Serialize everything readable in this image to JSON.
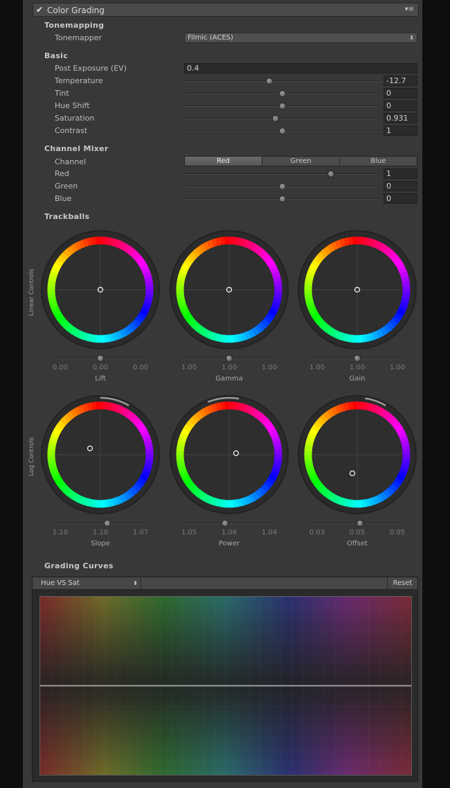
{
  "header": {
    "title": "Color Grading",
    "enabled": true,
    "menu_icon": "settings-menu-icon"
  },
  "tonemapping": {
    "section": "Tonemapping",
    "tonemapper_label": "Tonemapper",
    "tonemapper_value": "Filmic (ACES)"
  },
  "basic": {
    "section": "Basic",
    "post_exposure_label": "Post Exposure (EV)",
    "post_exposure_value": "0.4",
    "sliders": [
      {
        "label": "Temperature",
        "value": "-12.7",
        "pos": 0.436
      },
      {
        "label": "Tint",
        "value": "0",
        "pos": 0.5
      },
      {
        "label": "Hue Shift",
        "value": "0",
        "pos": 0.5
      },
      {
        "label": "Saturation",
        "value": "0.931",
        "pos": 0.465
      },
      {
        "label": "Contrast",
        "value": "1",
        "pos": 0.5
      }
    ]
  },
  "channel_mixer": {
    "section": "Channel Mixer",
    "channel_label": "Channel",
    "tabs": [
      "Red",
      "Green",
      "Blue"
    ],
    "active_tab": 0,
    "sliders": [
      {
        "label": "Red",
        "value": "1",
        "pos": 0.75
      },
      {
        "label": "Green",
        "value": "0",
        "pos": 0.5
      },
      {
        "label": "Blue",
        "value": "0",
        "pos": 0.5
      }
    ]
  },
  "trackballs": {
    "section": "Trackballs",
    "linear_label": "Linear Controls",
    "log_label": "Log Controls",
    "linear": [
      {
        "name": "Lift",
        "values": [
          "0.00",
          "0.00",
          "0.00"
        ],
        "slider": 0.5
      },
      {
        "name": "Gamma",
        "values": [
          "1.00",
          "1.00",
          "1.00"
        ],
        "slider": 0.5
      },
      {
        "name": "Gain",
        "values": [
          "1.00",
          "1.00",
          "1.00"
        ],
        "slider": 0.5
      }
    ],
    "log": [
      {
        "name": "Slope",
        "values": [
          "1.10",
          "1.10",
          "1.07"
        ],
        "slider": 0.58
      },
      {
        "name": "Power",
        "values": [
          "1.05",
          "1.06",
          "1.04"
        ],
        "slider": 0.45
      },
      {
        "name": "Offset",
        "values": [
          "0.03",
          "0.05",
          "0.05"
        ],
        "slider": 0.53
      }
    ]
  },
  "grading_curves": {
    "section": "Grading Curves",
    "curve_type": "Hue VS Sat",
    "reset_label": "Reset"
  }
}
